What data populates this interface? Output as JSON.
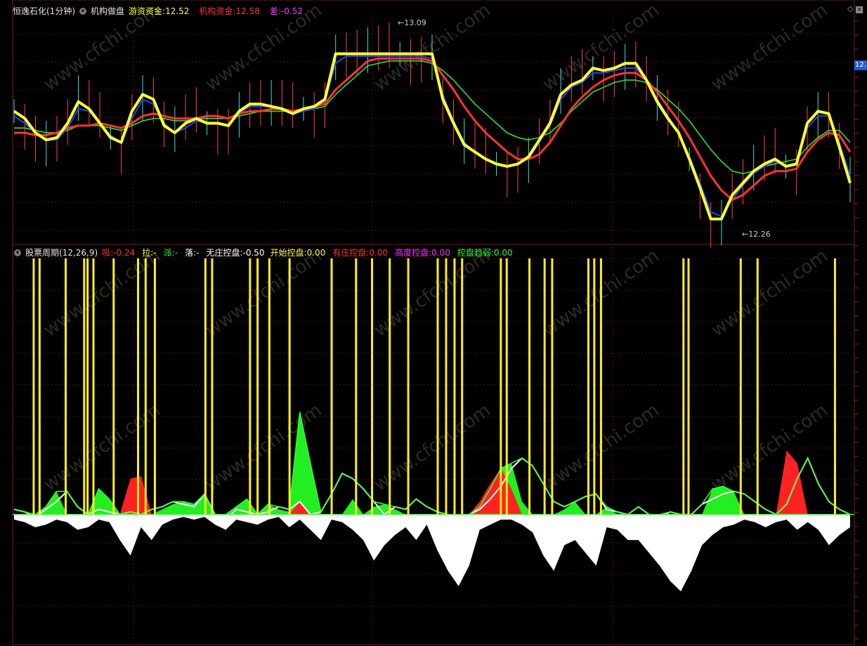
{
  "top_panel": {
    "stock_label": "恒逸石化(1分钟)",
    "indicator_name": "机构做盘",
    "items": [
      {
        "label": "游资资金:",
        "value": "12.52",
        "color": "#ffff33"
      },
      {
        "label": "机构资金:",
        "value": "12.58",
        "color": "#ff3333"
      },
      {
        "label": "差:",
        "value": "-0.52",
        "color": "#ff33ff"
      }
    ],
    "high_label": "13.09",
    "low_label": "12.26",
    "price_box": "12."
  },
  "bottom_panel": {
    "indicator_name": "股票周期(12,26,9)",
    "items": [
      {
        "label": "吸:",
        "value": "-0.24",
        "color": "#ff3333"
      },
      {
        "label": "拉:",
        "value": "-",
        "color": "#ffff33"
      },
      {
        "label": "派:",
        "value": "-",
        "color": "#33ff33"
      },
      {
        "label": "落:",
        "value": "-",
        "color": "#ffffff"
      },
      {
        "label": "无庄控盘:",
        "value": "-0.50",
        "color": "#ffffff"
      },
      {
        "label": "开始控盘:",
        "value": "0.00",
        "color": "#ffff33"
      },
      {
        "label": "有庄控盘:",
        "value": "0.00",
        "color": "#ff3333"
      },
      {
        "label": "高度控盘:",
        "value": "0.00",
        "color": "#ff33ff"
      },
      {
        "label": "控盘趋弱:",
        "value": "0.00",
        "color": "#33ff33"
      }
    ]
  },
  "watermark": "www.cfchi.com",
  "chart_data": [
    {
      "type": "line",
      "title": "机构做盘",
      "ylim": [
        12.2,
        13.15
      ],
      "series": [
        {
          "name": "游资资金",
          "color": "#ffff33",
          "values": [
            12.75,
            12.72,
            12.66,
            12.63,
            12.64,
            12.7,
            12.79,
            12.76,
            12.7,
            12.64,
            12.62,
            12.75,
            12.82,
            12.8,
            12.69,
            12.66,
            12.7,
            12.72,
            12.7,
            12.7,
            12.69,
            12.75,
            12.78,
            12.78,
            12.77,
            12.76,
            12.74,
            12.76,
            12.77,
            12.8,
            12.99,
            12.99,
            12.99,
            12.99,
            12.99,
            12.99,
            12.99,
            12.99,
            12.99,
            12.99,
            12.8,
            12.7,
            12.61,
            12.58,
            12.55,
            12.53,
            12.52,
            12.53,
            12.56,
            12.63,
            12.7,
            12.82,
            12.86,
            12.88,
            12.93,
            12.92,
            12.93,
            12.95,
            12.95,
            12.88,
            12.79,
            12.72,
            12.66,
            12.55,
            12.43,
            12.3,
            12.3,
            12.4,
            12.45,
            12.5,
            12.53,
            12.55,
            12.52,
            12.53,
            12.7,
            12.75,
            12.74,
            12.6,
            12.45
          ]
        },
        {
          "name": "机构资金",
          "color": "#ff3333",
          "values": [
            12.66,
            12.66,
            12.65,
            12.65,
            12.66,
            12.68,
            12.69,
            12.69,
            12.7,
            12.69,
            12.68,
            12.7,
            12.73,
            12.74,
            12.73,
            12.72,
            12.72,
            12.72,
            12.73,
            12.73,
            12.72,
            12.74,
            12.75,
            12.75,
            12.76,
            12.76,
            12.75,
            12.76,
            12.77,
            12.78,
            12.84,
            12.88,
            12.92,
            12.96,
            12.97,
            12.97,
            12.97,
            12.97,
            12.97,
            12.96,
            12.9,
            12.84,
            12.77,
            12.71,
            12.66,
            12.62,
            12.58,
            12.55,
            12.55,
            12.57,
            12.62,
            12.69,
            12.76,
            12.81,
            12.85,
            12.88,
            12.9,
            12.91,
            12.91,
            12.88,
            12.83,
            12.77,
            12.71,
            12.64,
            12.56,
            12.48,
            12.42,
            12.38,
            12.4,
            12.44,
            12.48,
            12.5,
            12.5,
            12.51,
            12.58,
            12.63,
            12.66,
            12.65,
            12.58
          ]
        },
        {
          "name": "",
          "color": "#33dd33",
          "values": [
            12.68,
            12.68,
            12.67,
            12.66,
            12.66,
            12.67,
            12.69,
            12.69,
            12.69,
            12.68,
            12.67,
            12.69,
            12.71,
            12.72,
            12.72,
            12.71,
            12.71,
            12.72,
            12.72,
            12.72,
            12.72,
            12.73,
            12.74,
            12.75,
            12.75,
            12.75,
            12.75,
            12.75,
            12.76,
            12.77,
            12.82,
            12.86,
            12.9,
            12.94,
            12.95,
            12.96,
            12.96,
            12.96,
            12.96,
            12.95,
            12.92,
            12.88,
            12.83,
            12.78,
            12.74,
            12.7,
            12.66,
            12.64,
            12.63,
            12.64,
            12.66,
            12.7,
            12.75,
            12.79,
            12.83,
            12.85,
            12.87,
            12.88,
            12.88,
            12.87,
            12.84,
            12.8,
            12.76,
            12.71,
            12.65,
            12.59,
            12.54,
            12.5,
            12.49,
            12.5,
            12.52,
            12.53,
            12.54,
            12.55,
            12.6,
            12.64,
            12.67,
            12.67,
            12.62
          ]
        },
        {
          "name": "",
          "color": "#2244ff",
          "values": [
            12.73,
            12.7,
            12.66,
            12.63,
            12.63,
            12.68,
            12.76,
            12.75,
            12.7,
            12.65,
            12.62,
            12.72,
            12.8,
            12.78,
            12.7,
            12.66,
            12.68,
            12.71,
            12.7,
            12.7,
            12.69,
            12.74,
            12.77,
            12.77,
            12.77,
            12.76,
            12.74,
            12.75,
            12.76,
            12.79,
            12.95,
            12.98,
            12.98,
            12.98,
            12.98,
            12.98,
            12.98,
            12.98,
            12.98,
            12.97,
            12.82,
            12.71,
            12.62,
            12.58,
            12.55,
            12.53,
            12.52,
            12.53,
            12.55,
            12.62,
            12.69,
            12.8,
            12.85,
            12.87,
            12.91,
            12.91,
            12.92,
            12.93,
            12.93,
            12.88,
            12.8,
            12.73,
            12.66,
            12.56,
            12.45,
            12.33,
            12.31,
            12.38,
            12.44,
            12.49,
            12.52,
            12.54,
            12.52,
            12.53,
            12.68,
            12.73,
            12.73,
            12.62,
            12.48
          ]
        }
      ]
    },
    {
      "type": "bar",
      "title": "股票周期(12,26,9)",
      "ylim": [
        -0.5,
        1.0
      ],
      "signal_bars": [
        0.025,
        0.032,
        0.063,
        0.085,
        0.089,
        0.096,
        0.12,
        0.149,
        0.158,
        0.169,
        0.229,
        0.237,
        0.282,
        0.291,
        0.305,
        0.329,
        0.379,
        0.408,
        0.427,
        0.448,
        0.47,
        0.505,
        0.515,
        0.525,
        0.534,
        0.58,
        0.587,
        0.614,
        0.632,
        0.641,
        0.684,
        0.691,
        0.699,
        0.797,
        0.803,
        0.865,
        0.885,
        0.977
      ],
      "white_line": [
        0.02,
        0.01,
        -0.01,
        0.02,
        0.05,
        0.09,
        0.03,
        0.0,
        0.02,
        0.01,
        0.0,
        0.01,
        0.0,
        0.02,
        0.03,
        0.05,
        0.04,
        0.03,
        0.08,
        0.0,
        -0.02,
        0.02,
        0.01,
        0.0,
        0.01,
        0.03,
        0.02,
        0.05,
        0.0,
        0.01,
        0.08,
        0.16,
        0.14,
        0.1,
        0.05,
        0.0,
        0.03,
        0.02,
        0.06,
        0.03,
        0.01,
        0.0,
        -0.02,
        0.0,
        0.02,
        0.06,
        0.11,
        0.18,
        0.22,
        0.19,
        0.12,
        0.05,
        0.03,
        0.05,
        0.07,
        0.08,
        0.02,
        0.01,
        0.0,
        0.03,
        0.0,
        -0.01,
        0.01,
        0.0,
        0.0,
        0.04,
        0.06,
        0.08,
        0.09,
        0.08,
        0.05,
        0.02,
        0.0,
        0.04,
        0.14,
        0.22,
        0.12,
        0.05,
        0.02,
        0.0
      ],
      "green_fill": [
        0.0,
        0.0,
        0.0,
        0.03,
        0.09,
        0.0,
        0.0,
        0.0,
        0.1,
        0.06,
        0.0,
        0.0,
        0.0,
        0.0,
        0.02,
        0.04,
        0.05,
        0.04,
        0.08,
        0.0,
        0.0,
        0.03,
        0.06,
        0.0,
        0.04,
        0.02,
        0.01,
        0.4,
        0.2,
        0.0,
        0.0,
        0.0,
        0.06,
        0.0,
        0.03,
        0.04,
        0.02,
        0.0,
        0.0,
        0.0,
        0.0,
        0.0,
        0.0,
        0.0,
        0.03,
        0.1,
        0.18,
        0.2,
        0.05,
        0.0,
        0.0,
        0.0,
        0.02,
        0.05,
        0.0,
        0.0,
        0.03,
        0.0,
        0.0,
        0.0,
        0.0,
        0.0,
        0.0,
        0.0,
        0.0,
        0.0,
        0.1,
        0.11,
        0.09,
        0.0,
        0.0,
        0.0,
        0.0,
        0.0,
        0.0,
        0.0,
        0.0,
        0.0,
        0.0,
        0.0
      ],
      "red_fill": [
        0.0,
        0.0,
        0.0,
        0.0,
        0.0,
        0.0,
        0.0,
        0.0,
        0.0,
        0.0,
        0.0,
        0.14,
        0.15,
        0.0,
        0.0,
        0.0,
        0.0,
        0.0,
        0.0,
        0.0,
        0.0,
        0.0,
        0.0,
        0.0,
        0.0,
        0.0,
        0.0,
        0.05,
        0.0,
        0.0,
        0.0,
        0.0,
        0.0,
        0.0,
        0.0,
        0.0,
        0.0,
        0.0,
        0.0,
        0.0,
        0.0,
        0.0,
        0.0,
        0.0,
        0.05,
        0.12,
        0.18,
        0.1,
        0.0,
        0.0,
        0.0,
        0.0,
        0.0,
        0.0,
        0.0,
        0.0,
        0.0,
        0.0,
        0.0,
        0.0,
        0.0,
        0.0,
        0.0,
        0.0,
        0.0,
        0.0,
        0.0,
        0.0,
        0.0,
        0.0,
        0.0,
        0.0,
        0.0,
        0.25,
        0.2,
        0.0,
        0.0,
        0.0,
        0.0,
        0.0
      ],
      "negative_fill": [
        -0.02,
        -0.03,
        -0.05,
        -0.04,
        -0.02,
        -0.03,
        -0.06,
        -0.05,
        -0.02,
        -0.03,
        -0.1,
        -0.16,
        -0.05,
        -0.1,
        -0.04,
        -0.02,
        -0.01,
        -0.02,
        -0.01,
        -0.04,
        -0.06,
        -0.02,
        -0.03,
        -0.04,
        -0.02,
        -0.01,
        -0.05,
        -0.02,
        -0.06,
        -0.1,
        -0.02,
        -0.03,
        -0.06,
        -0.1,
        -0.18,
        -0.12,
        -0.08,
        -0.05,
        -0.1,
        -0.04,
        -0.14,
        -0.22,
        -0.28,
        -0.2,
        -0.06,
        -0.04,
        -0.02,
        -0.02,
        -0.04,
        -0.07,
        -0.16,
        -0.22,
        -0.12,
        -0.1,
        -0.15,
        -0.2,
        -0.05,
        -0.06,
        -0.1,
        -0.1,
        -0.15,
        -0.2,
        -0.26,
        -0.3,
        -0.22,
        -0.12,
        -0.08,
        -0.05,
        -0.04,
        -0.02,
        -0.03,
        -0.05,
        -0.03,
        -0.02,
        -0.06,
        -0.03,
        -0.06,
        -0.12,
        -0.08,
        -0.05
      ]
    }
  ]
}
